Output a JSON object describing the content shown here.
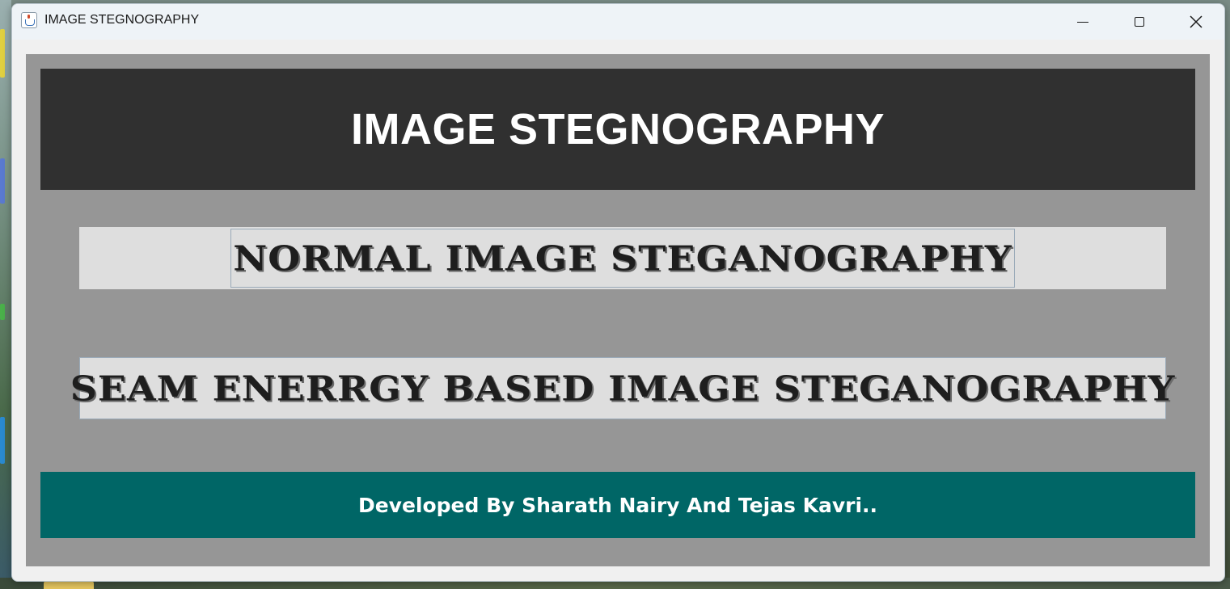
{
  "window": {
    "title": "IMAGE STEGNOGRAPHY",
    "controls": {
      "minimize": "minimize",
      "maximize": "maximize",
      "close": "close"
    }
  },
  "header": {
    "title": "IMAGE STEGNOGRAPHY"
  },
  "buttons": {
    "normal_label": "NORMAL IMAGE STEGANOGRAPHY",
    "seam_label": "SEAM ENERRGY BASED IMAGE STEGANOGRAPHY"
  },
  "footer": {
    "credit": "Developed By Sharath Nairy And Tejas Kavri.."
  },
  "colors": {
    "content_bg": "#969696",
    "header_bg": "#303030",
    "button_bg": "#dedede",
    "footer_bg": "#006666",
    "title_text": "#ffffff"
  }
}
